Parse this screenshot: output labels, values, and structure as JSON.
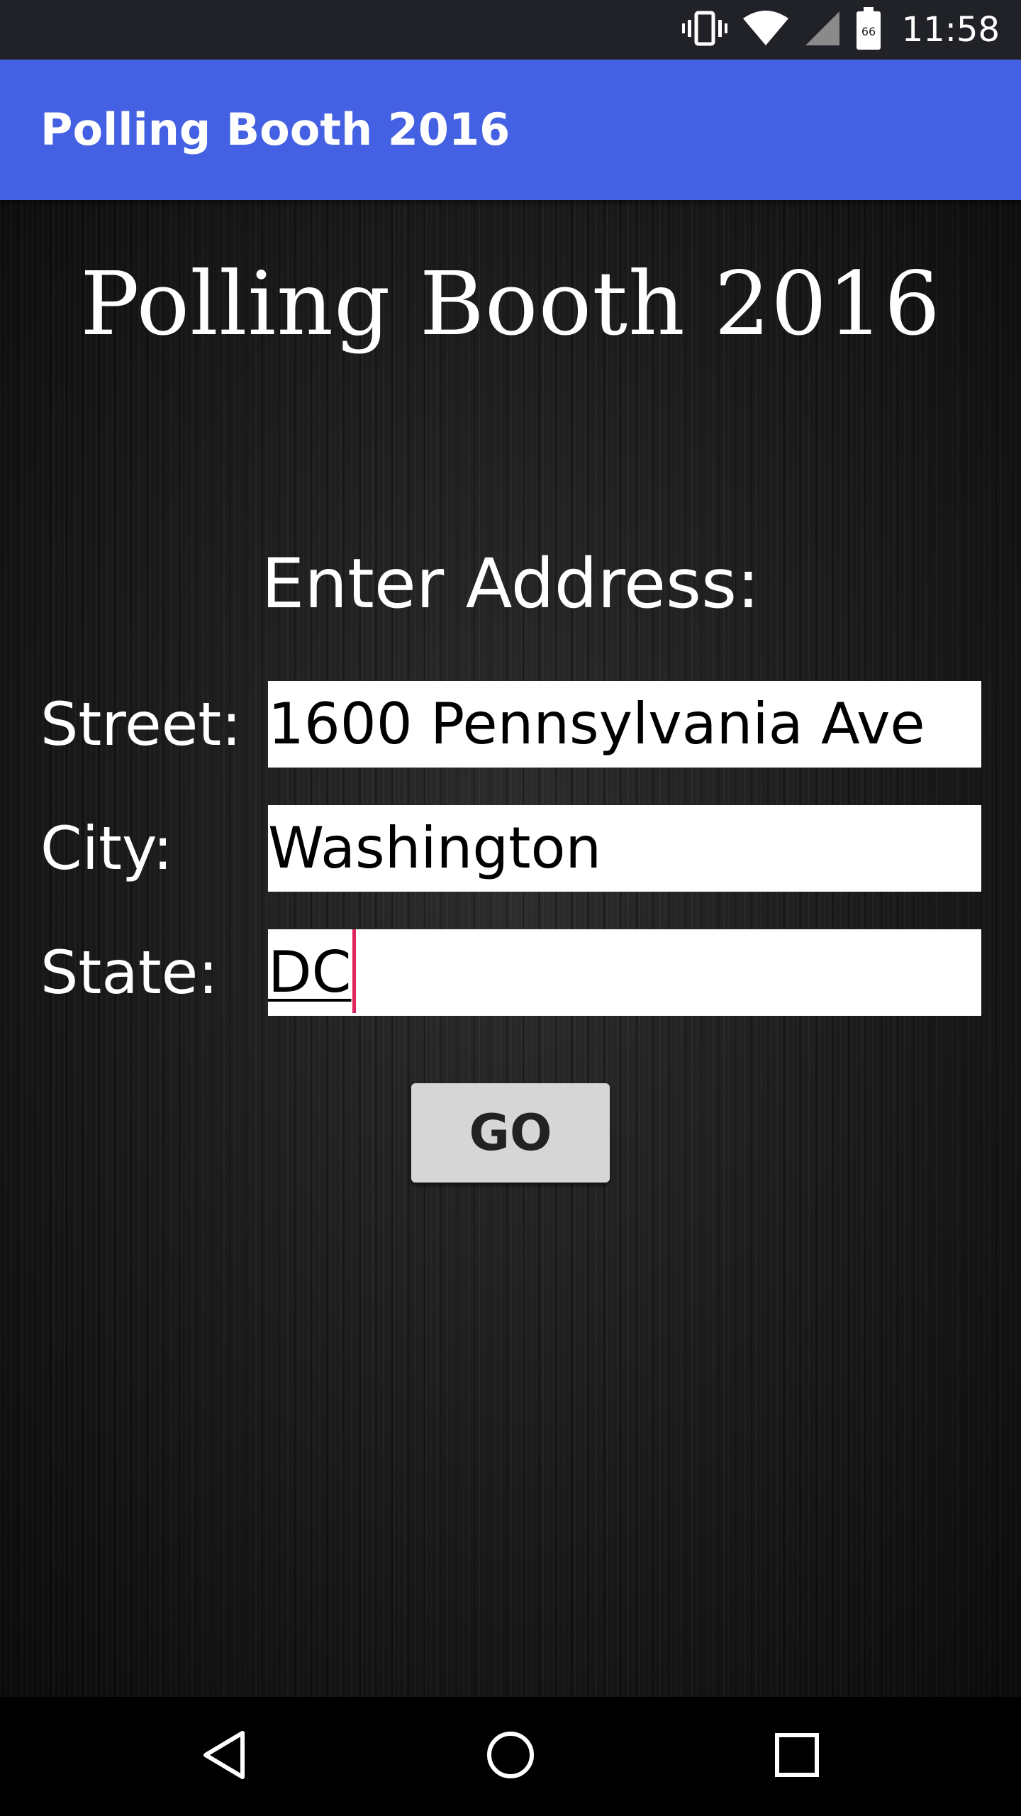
{
  "status_bar": {
    "time": "11:58",
    "icons": [
      "vibrate-icon",
      "wifi-icon",
      "cell-signal-icon",
      "battery-icon"
    ]
  },
  "app_bar": {
    "title": "Polling Booth 2016",
    "color": "#4361E2"
  },
  "main": {
    "title": "Polling Booth 2016",
    "prompt": "Enter Address:",
    "fields": {
      "street": {
        "label": "Street:",
        "value": "1600 Pennsylvania Ave"
      },
      "city": {
        "label": "City:",
        "value": "Washington"
      },
      "state": {
        "label": "State:",
        "value": "DC",
        "focused": true
      }
    },
    "go_button_label": "GO"
  },
  "nav_bar": {
    "buttons": [
      "back-icon",
      "home-icon",
      "recents-icon"
    ]
  },
  "colors": {
    "accent_cursor": "#E0245E",
    "button_bg": "#D6D6D6"
  }
}
